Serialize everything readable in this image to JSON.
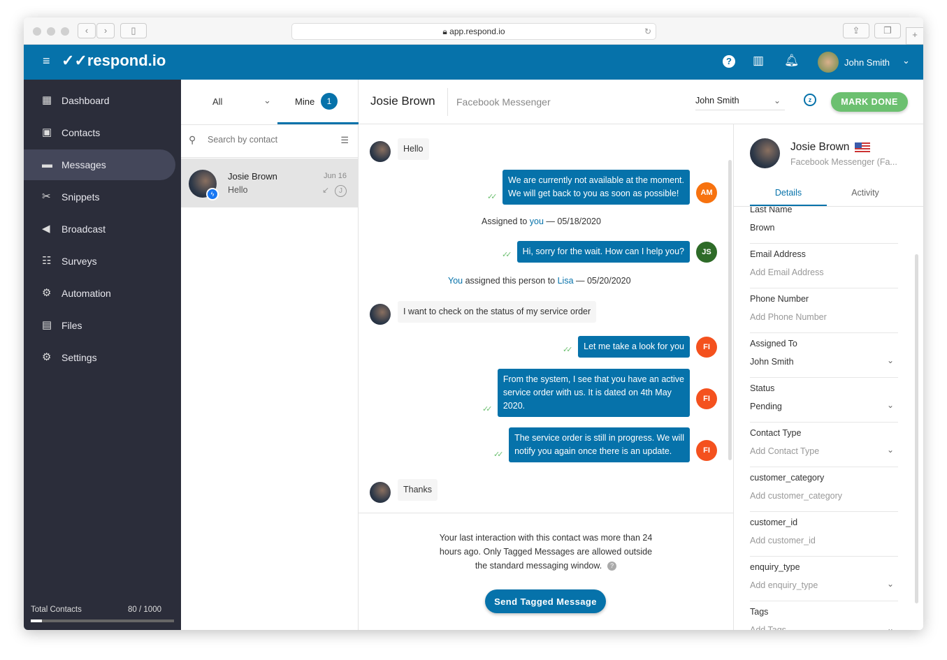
{
  "browser": {
    "url": "app.respond.io"
  },
  "app": {
    "logo": "respond.io",
    "user_name": "John Smith"
  },
  "sidebar": {
    "items": [
      {
        "label": "Dashboard",
        "icon": "dashboard-icon"
      },
      {
        "label": "Contacts",
        "icon": "contacts-icon"
      },
      {
        "label": "Messages",
        "icon": "messages-icon",
        "active": true
      },
      {
        "label": "Snippets",
        "icon": "scissors-icon"
      },
      {
        "label": "Broadcast",
        "icon": "megaphone-icon"
      },
      {
        "label": "Surveys",
        "icon": "survey-list-icon"
      },
      {
        "label": "Automation",
        "icon": "gears-icon"
      },
      {
        "label": "Files",
        "icon": "file-icon"
      },
      {
        "label": "Settings",
        "icon": "gear-icon"
      }
    ],
    "total_contacts_label": "Total Contacts",
    "total_contacts_value": "80 / 1000",
    "total_contacts_fraction": 0.08
  },
  "list": {
    "filter_all": "All",
    "filter_mine": "Mine",
    "mine_count": "1",
    "search_placeholder": "Search by contact",
    "conversations": [
      {
        "name": "Josie Brown",
        "preview": "Hello",
        "date": "Jun 16",
        "assignee_initial": "J"
      }
    ]
  },
  "chat": {
    "contact_name": "Josie Brown",
    "channel": "Facebook Messenger",
    "assignee": "John Smith",
    "mark_done": "MARK DONE",
    "messages": [
      {
        "type": "in",
        "text": "Hello"
      },
      {
        "type": "out",
        "lines": [
          "We are currently not available at the moment.",
          "We will get back to you as soon as possible!"
        ],
        "avatar": "AM",
        "color": "#f7720f"
      },
      {
        "type": "sys",
        "parts": [
          [
            "Assigned to ",
            ""
          ],
          [
            "you",
            "b"
          ],
          [
            " — 05/18/2020",
            ""
          ]
        ]
      },
      {
        "type": "out",
        "lines": [
          "Hi, sorry for the wait. How can I help you?"
        ],
        "avatar": "JS",
        "color": "#2e6b28"
      },
      {
        "type": "sys",
        "parts": [
          [
            "You",
            "b"
          ],
          [
            " assigned this person to ",
            ""
          ],
          [
            "Lisa",
            "b"
          ],
          [
            " — 05/20/2020",
            ""
          ]
        ]
      },
      {
        "type": "in",
        "text": "I want to check on the status of my service order"
      },
      {
        "type": "out",
        "lines": [
          "Let me take a look for you"
        ],
        "avatar": "FI",
        "color": "#f4511e"
      },
      {
        "type": "out",
        "lines": [
          "From the system, I see that you have an active",
          "service order with us. It is dated on 4th May",
          "2020."
        ],
        "avatar": "FI",
        "color": "#f4511e"
      },
      {
        "type": "out",
        "lines": [
          "The service order is still in progress. We will",
          "notify you again once there is an update."
        ],
        "avatar": "FI",
        "color": "#f4511e"
      },
      {
        "type": "in",
        "text": "Thanks"
      }
    ],
    "notice_lines": [
      "Your last interaction with this contact was more than 24",
      "hours ago. Only Tagged Messages are allowed outside",
      "the standard messaging window."
    ],
    "send_tagged": "Send Tagged Message"
  },
  "contact": {
    "name": "Josie Brown",
    "channel": "Facebook Messenger (Fa...",
    "tabs": [
      "Details",
      "Activity"
    ],
    "fields": [
      {
        "label": "Last Name",
        "value": "Brown"
      },
      {
        "label": "Email Address",
        "placeholder": "Add Email Address"
      },
      {
        "label": "Phone Number",
        "placeholder": "Add Phone Number"
      },
      {
        "label": "Assigned To",
        "value": "John Smith",
        "dropdown": true
      },
      {
        "label": "Status",
        "value": "Pending",
        "dropdown": true
      },
      {
        "label": "Contact Type",
        "placeholder": "Add Contact Type",
        "dropdown": true
      },
      {
        "label": "customer_category",
        "placeholder": "Add customer_category"
      },
      {
        "label": "customer_id",
        "placeholder": "Add customer_id"
      },
      {
        "label": "enquiry_type",
        "placeholder": "Add enquiry_type",
        "dropdown": true
      },
      {
        "label": "Tags",
        "placeholder": "Add Tags",
        "dropdown": true
      }
    ]
  },
  "colors": {
    "brand": "#0672aa",
    "sidebar": "#2b2d3a",
    "mark_done": "#6cc070"
  }
}
